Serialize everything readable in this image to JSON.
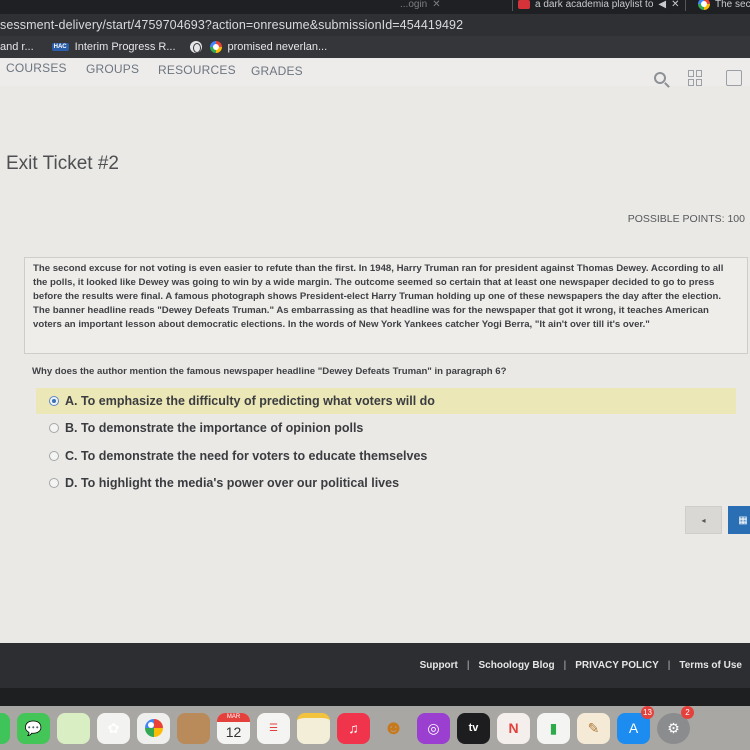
{
  "browser": {
    "tabs": [
      {
        "label": "...ogin",
        "active": false
      },
      {
        "label": "a dark academia playlist to",
        "active": false
      },
      {
        "label": "The sec",
        "active": false
      }
    ],
    "url": "sessment-delivery/start/4759704693?action=onresume&submissionId=454419492",
    "bookmarks": [
      {
        "label": "and r...",
        "icon": "partial"
      },
      {
        "label": "Interim Progress R...",
        "icon": "hac-icon"
      },
      {
        "label": "",
        "icon": "globe-icon"
      },
      {
        "label": "promised neverlan...",
        "icon": "google-icon"
      }
    ]
  },
  "nav": {
    "items": [
      "COURSES",
      "GROUPS",
      "RESOURCES",
      "GRADES"
    ],
    "icons": [
      "search-icon",
      "apps-grid-icon",
      "calendar-icon"
    ]
  },
  "assessment": {
    "title": "Exit Ticket #2",
    "possible_points": "POSSIBLE POINTS: 100",
    "passage": "The second excuse for not voting is even easier to refute than the first. In 1948, Harry Truman ran for president against Thomas Dewey. According to all the polls, it looked like Dewey was going to win by a wide margin. The outcome seemed so certain that at least one newspaper decided to go to press before the results were final. A famous photograph shows President-elect Harry Truman holding up one of these newspapers the day after the election. The banner headline reads \"Dewey Defeats Truman.\" As embarrassing as that headline was for the newspaper that got it wrong, it teaches American voters an important lesson about democratic elections. In the words of New York Yankees catcher Yogi Berra, \"It ain't over till it's over.\"",
    "question": "Why does the author mention the famous newspaper headline \"Dewey Defeats Truman\" in paragraph 6?",
    "choices": [
      {
        "label": "A. To emphasize the difficulty of predicting what voters will do",
        "selected": true
      },
      {
        "label": "B. To demonstrate the importance of opinion polls",
        "selected": false
      },
      {
        "label": "C. To demonstrate the need for voters to educate themselves",
        "selected": false
      },
      {
        "label": "D. To highlight the media's power over our political lives",
        "selected": false
      }
    ],
    "prev_button": "◂",
    "next_button": "▦"
  },
  "footer": {
    "links": [
      "Support",
      "Schoology Blog",
      "PRIVACY POLICY",
      "Terms of Use"
    ],
    "separator": "|"
  },
  "dock": {
    "calendar_month": "MAR",
    "calendar_day": "12",
    "appstore_badge": "13",
    "settings_badge": "2",
    "tv_label": "tv"
  }
}
